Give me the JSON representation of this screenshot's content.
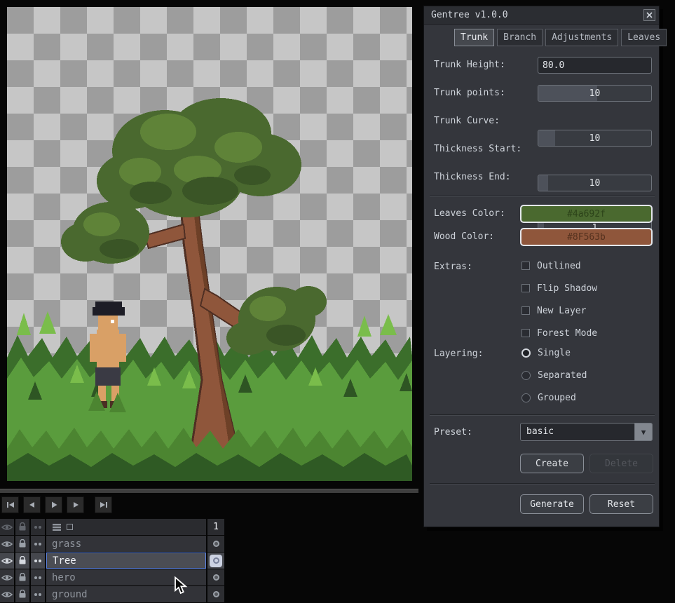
{
  "dialog": {
    "title": "Gentree v1.0.0",
    "tabs": [
      {
        "label": "Trunk"
      },
      {
        "label": "Branch"
      },
      {
        "label": "Adjustments"
      },
      {
        "label": "Leaves"
      }
    ],
    "trunk": {
      "height": {
        "label": "Trunk Height:",
        "value": "80.0"
      },
      "points": {
        "label": "Trunk points:",
        "value": "10",
        "fill": 52
      },
      "curve": {
        "label": "Trunk Curve:",
        "value": "10",
        "fill": 15
      },
      "thickness_start": {
        "label": "Thickness Start:",
        "value": "10",
        "fill": 9
      },
      "thickness_end": {
        "label": "Thickness End:",
        "value": "1",
        "fill": 5
      }
    },
    "colors": {
      "leaves": {
        "label": "Leaves Color:",
        "value": "#4a692f",
        "hex": "#4a692f"
      },
      "wood": {
        "label": "Wood Color:",
        "value": "#8F563b",
        "hex": "#8f563b"
      }
    },
    "extras": {
      "label": "Extras:",
      "options": [
        "Outlined",
        "Flip Shadow",
        "New Layer",
        "Forest Mode"
      ]
    },
    "layering": {
      "label": "Layering:",
      "options": [
        "Single",
        "Separated",
        "Grouped"
      ],
      "selected": "Single"
    },
    "preset": {
      "label": "Preset:",
      "value": "basic"
    },
    "preset_buttons": {
      "create": "Create",
      "delete": "Delete"
    },
    "footer_buttons": {
      "generate": "Generate",
      "reset": "Reset"
    }
  },
  "timeline": {
    "frame": "1",
    "selected_layer": "Tree",
    "layers": [
      {
        "name": "grass"
      },
      {
        "name": "Tree"
      },
      {
        "name": "hero"
      },
      {
        "name": "ground"
      }
    ]
  },
  "canvas": {
    "leaves_color": "#4a692f",
    "wood_color": "#8f563b",
    "grass_color": "#5a9c3d"
  }
}
